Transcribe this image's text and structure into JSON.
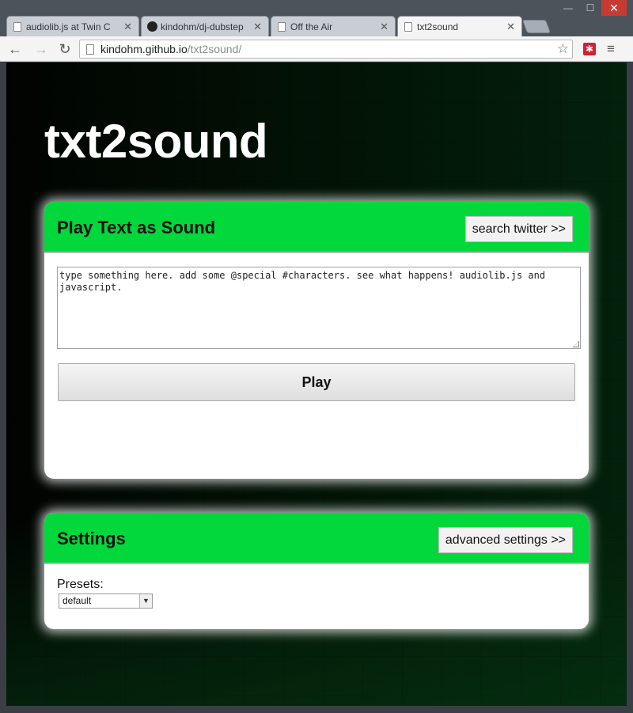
{
  "browser": {
    "tabs": [
      {
        "title": "audiolib.js at Twin C",
        "icon": "page-icon",
        "active": false
      },
      {
        "title": "kindohm/dj-dubstep",
        "icon": "github-icon",
        "active": false
      },
      {
        "title": "Off the Air",
        "icon": "page-icon",
        "active": false
      },
      {
        "title": "txt2sound",
        "icon": "page-icon",
        "active": true
      }
    ],
    "tab_close_glyph": "✕",
    "url_host": "kindohm.github.io",
    "url_path": "/txt2sound/",
    "window_controls": {
      "minimize": "—",
      "maximize": "☐",
      "close": "✕"
    },
    "extension_glyph": "✱",
    "menu_glyph": "≡",
    "back_glyph": "←",
    "forward_glyph": "→",
    "reload_glyph": "↻",
    "star_glyph": "☆"
  },
  "page": {
    "title": "txt2sound",
    "play_panel": {
      "title": "Play Text as Sound",
      "header_button": "search twitter >>",
      "text_value": "type something here. add some @special #characters. see what happens! audiolib.js and javascript.",
      "play_button": "Play"
    },
    "settings_panel": {
      "title": "Settings",
      "header_button": "advanced settings >>",
      "presets_label": "Presets:",
      "presets_selected": "default",
      "dropdown_arrow": "▼"
    }
  },
  "colors": {
    "panel_header": "#02d83b",
    "page_background": "#010301"
  }
}
